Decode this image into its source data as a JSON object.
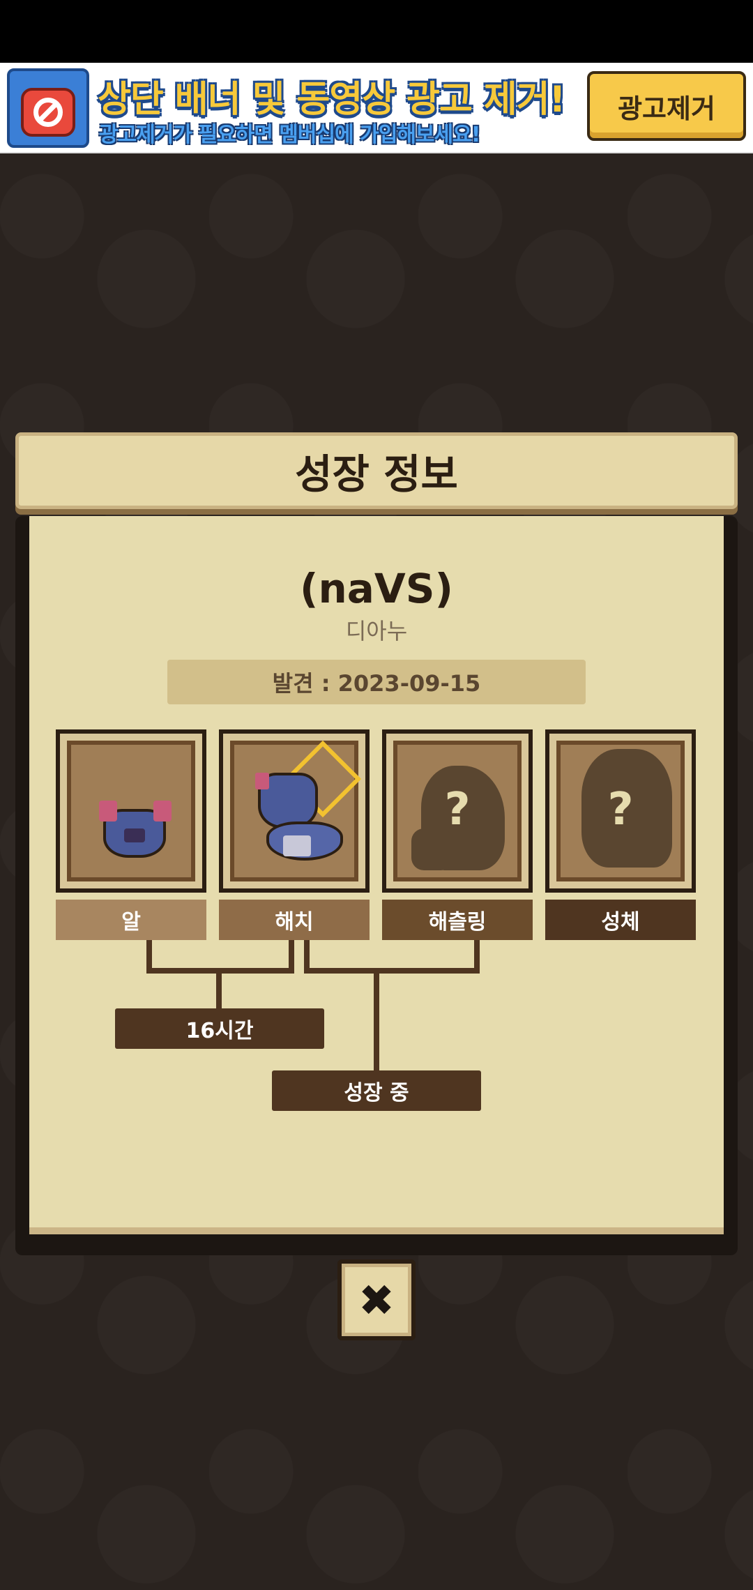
{
  "ad": {
    "title": "상단 배너 및 동영상 광고 제거!",
    "subtitle": "광고제거가 필요하면 멤버십에 가입해보세요!",
    "remove_button": "광고제거"
  },
  "panel": {
    "title": "성장 정보",
    "name": "(naVS)",
    "species": "디아누",
    "discovered": "발견 : 2023-09-15",
    "stages": [
      {
        "label": "알",
        "known": true
      },
      {
        "label": "해치",
        "known": true
      },
      {
        "label": "해츨링",
        "known": false,
        "unknown_mark": "?"
      },
      {
        "label": "성체",
        "known": false,
        "unknown_mark": "?"
      }
    ],
    "duration": "16시간",
    "status": "성장 중"
  },
  "close_icon": "close-icon"
}
